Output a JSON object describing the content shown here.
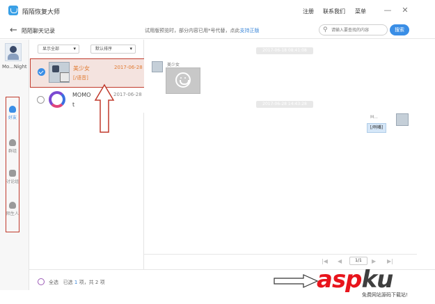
{
  "app": {
    "title": "陌陌恢复大师",
    "menu": [
      "注册",
      "联系我们",
      "菜单"
    ],
    "window_buttons": [
      "minimize-icon",
      "close-icon"
    ]
  },
  "header": {
    "page_title": "陌陌聊天记录",
    "notice_prefix": "试用版预览时，部分内容已用*号代替，点此",
    "notice_link": "支持正版",
    "search_placeholder": "请输入要查找的内容",
    "search_button": "搜索"
  },
  "rail": {
    "user_name": "Mo...Night",
    "items": [
      {
        "label": "好友",
        "icon": "person-icon"
      },
      {
        "label": "群组",
        "icon": "group-icon"
      },
      {
        "label": "讨论组",
        "icon": "chat-bubbles-icon"
      },
      {
        "label": "陌生人",
        "icon": "stranger-icon"
      }
    ]
  },
  "list": {
    "filter_show": "显示全部",
    "filter_sort": "默认排序",
    "rows": [
      {
        "name": "美少女",
        "date": "2017-06-28",
        "preview": "[/语音]",
        "selected": true
      },
      {
        "name": "MOMO",
        "name_line2": "t",
        "date": "2017-06-28",
        "preview": "",
        "selected": false
      }
    ]
  },
  "chat": {
    "timestamps": [
      "2017-06-18 08:41:08",
      "2017-06-28 14:43:28"
    ],
    "incoming_sender": "美少女",
    "outgoing_sender": "M...",
    "outgoing_text": "[/咧嘴]"
  },
  "pager": {
    "first": "|◀",
    "prev": "◀",
    "page": "1/1",
    "next": "▶",
    "last": "▶|"
  },
  "footer": {
    "select_all": "全选",
    "selected_prefix": "已选",
    "selected_count": "1",
    "selected_mid": "项，共",
    "total_count": "2",
    "selected_suffix": "项"
  },
  "watermark": {
    "brand": "aspku",
    "brand_suffix": ".com",
    "subtitle": "免费网站源码下载站!"
  },
  "colors": {
    "accent": "#3a8ee6",
    "highlight_text": "#e07b32",
    "annotation_red": "#c0392b"
  }
}
